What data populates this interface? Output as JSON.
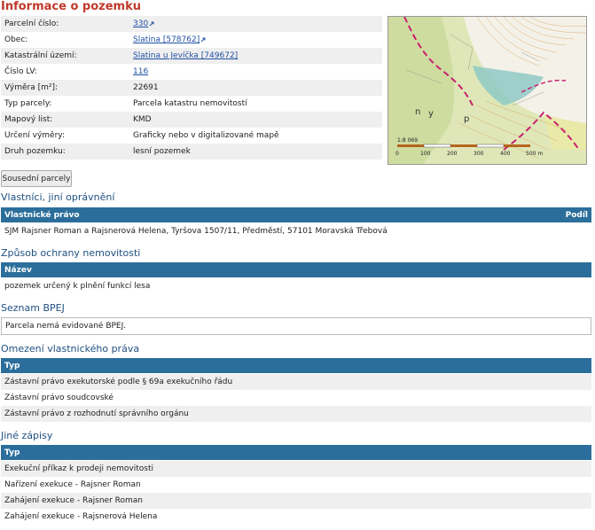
{
  "page_title": "Informace o pozemku",
  "info_rows": [
    {
      "label": "Parcelní číslo:",
      "value": "330",
      "link": true,
      "ext": true
    },
    {
      "label": "Obec:",
      "value": "Slatina [578762]",
      "link": true,
      "ext": true
    },
    {
      "label": "Katastrální území:",
      "value": "Slatina u Jevíčka [749672]",
      "link": true,
      "ext": false
    },
    {
      "label": "Číslo LV:",
      "value": "116",
      "link": true,
      "ext": false
    },
    {
      "label": "Výměra [m²]:",
      "value": "22691",
      "link": false,
      "ext": false
    },
    {
      "label": "Typ parcely:",
      "value": "Parcela katastru nemovitostí",
      "link": false,
      "ext": false
    },
    {
      "label": "Mapový list:",
      "value": "KMD",
      "link": false,
      "ext": false
    },
    {
      "label": "Určení výměry:",
      "value": "Graficky nebo v digitalizované mapě",
      "link": false,
      "ext": false
    },
    {
      "label": "Druh pozemku:",
      "value": "lesní pozemek",
      "link": false,
      "ext": false
    }
  ],
  "map": {
    "scale_label": "1:8 069",
    "scale_ticks": [
      "0",
      "100",
      "200",
      "300",
      "400",
      "500 m"
    ],
    "letters": [
      "n",
      "y",
      "p"
    ]
  },
  "neighbors_button": "Sousední parcely",
  "owners": {
    "title": "Vlastníci, jiní oprávnění",
    "col1": "Vlastnické právo",
    "col2": "Podíl",
    "rows": [
      "SJM Rajsner Roman a Rajsnerová Helena, Tyršova 1507/11, Předměstí, 57101 Moravská Třebová"
    ]
  },
  "protection": {
    "title": "Způsob ochrany nemovitosti",
    "col1": "Název",
    "rows": [
      "pozemek určený k plnění funkcí lesa"
    ]
  },
  "bpej": {
    "title": "Seznam BPEJ",
    "text": "Parcela nemá evidované BPEJ."
  },
  "restrictions": {
    "title": "Omezení vlastnického práva",
    "col1": "Typ",
    "rows": [
      "Zástavní právo exekutorské podle § 69a exekučního řádu",
      "Zástavní právo soudcovské",
      "Zástavní právo z rozhodnutí správního orgánu"
    ]
  },
  "other": {
    "title": "Jiné zápisy",
    "col1": "Typ",
    "rows": [
      "Exekuční příkaz k prodeji nemovitosti",
      "Nařízení exekuce - Rajsner Roman",
      "Zahájení exekuce - Rajsner Roman",
      "Zahájení exekuce - Rajsnerová Helena"
    ]
  }
}
